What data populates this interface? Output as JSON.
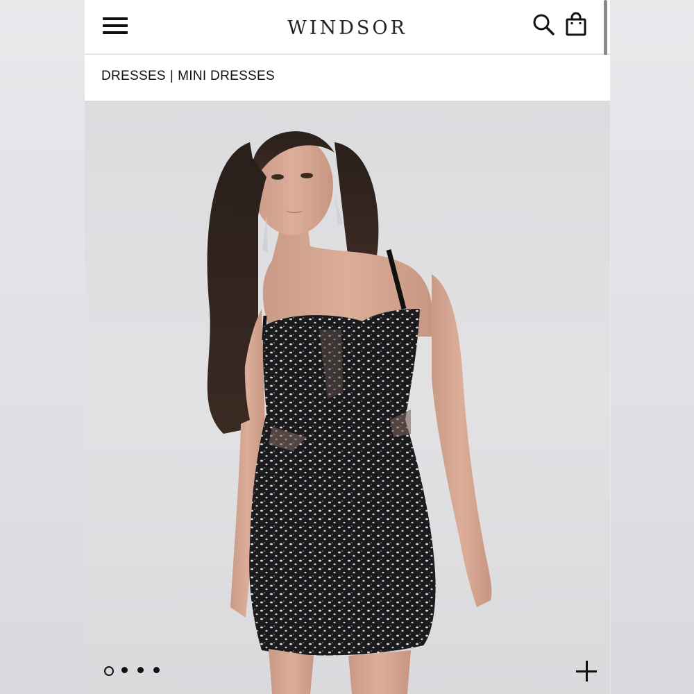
{
  "header": {
    "logo_text": "WINDSOR",
    "icons": [
      "menu-icon",
      "search-icon",
      "shopping-bag-icon"
    ]
  },
  "breadcrumb": {
    "items": [
      "DRESSES",
      "MINI DRESSES"
    ],
    "separator": "|"
  },
  "product_gallery": {
    "image_description_icon": "product-photo",
    "carousel": {
      "total": 4,
      "active_index": 0
    },
    "expand_icon": "plus-icon"
  },
  "colors": {
    "background": "#ffffff",
    "text": "#111111",
    "photo_backdrop": "#dfdfe2",
    "dress": "#1a1a1c"
  }
}
